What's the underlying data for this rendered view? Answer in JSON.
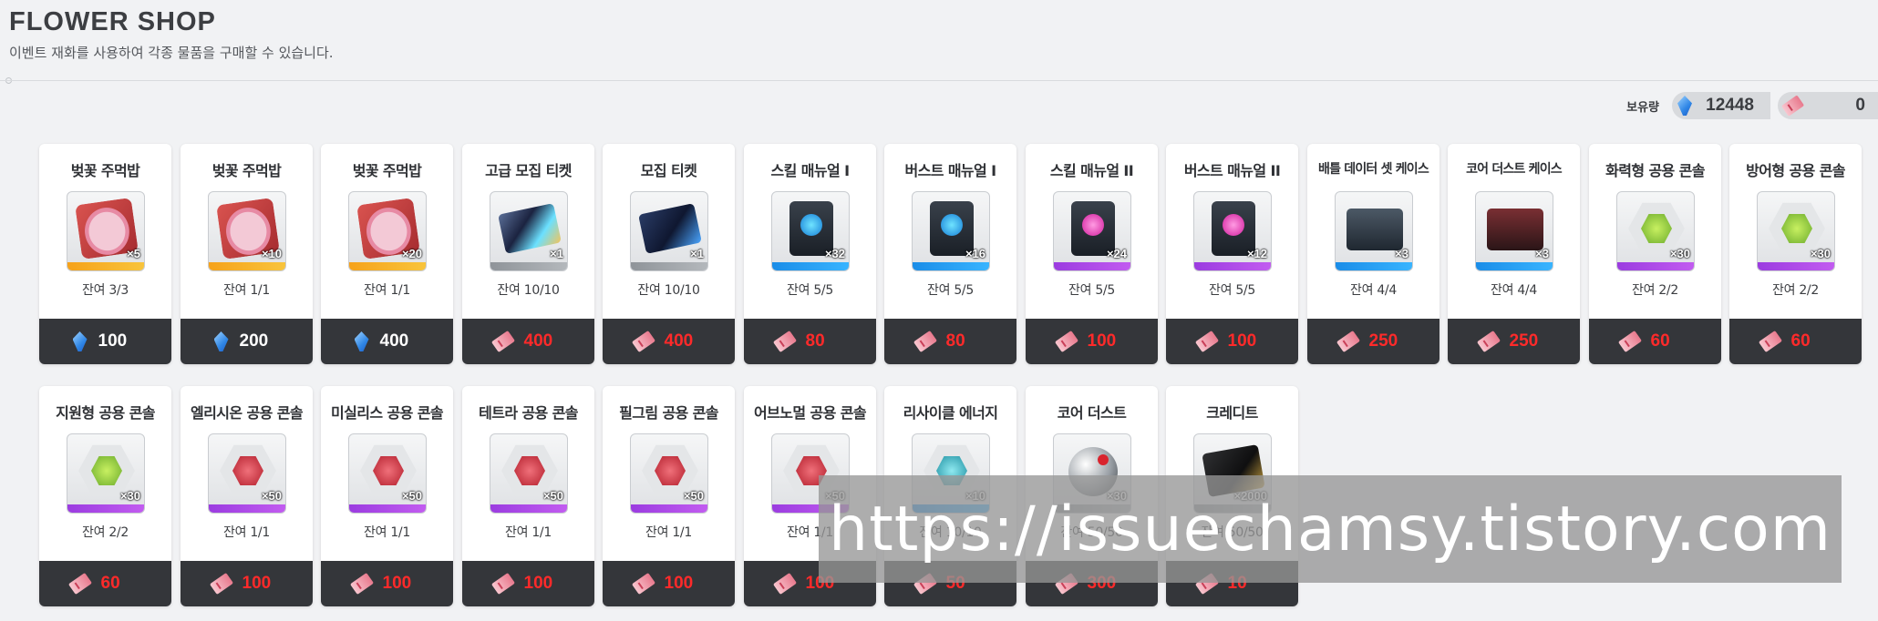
{
  "header": {
    "title": "FLOWER SHOP",
    "subtitle": "이벤트 재화를 사용하여 각종 물품을 구매할 수 있습니다."
  },
  "wallet": {
    "label": "보유량",
    "gem_amount": "12448",
    "ticket_amount": "0"
  },
  "items": [
    {
      "name": "벚꽃 주먹밥",
      "qty": "×5",
      "remain": "잔여 3/3",
      "currency": "gem",
      "price": "100",
      "rarity": "orange",
      "art": "rice"
    },
    {
      "name": "벚꽃 주먹밥",
      "qty": "×10",
      "remain": "잔여 1/1",
      "currency": "gem",
      "price": "200",
      "rarity": "orange",
      "art": "rice"
    },
    {
      "name": "벚꽃 주먹밥",
      "qty": "×20",
      "remain": "잔여 1/1",
      "currency": "gem",
      "price": "400",
      "rarity": "orange",
      "art": "rice"
    },
    {
      "name": "고급 모집 티켓",
      "qty": "×1",
      "remain": "잔여 10/10",
      "currency": "ticket",
      "price": "400",
      "rarity": "gray",
      "art": "ticket-gold"
    },
    {
      "name": "모집 티켓",
      "qty": "×1",
      "remain": "잔여 10/10",
      "currency": "ticket",
      "price": "400",
      "rarity": "gray",
      "art": "ticket"
    },
    {
      "name": "스킬 매뉴얼 I",
      "qty": "×32",
      "remain": "잔여 5/5",
      "currency": "ticket",
      "price": "80",
      "rarity": "blue",
      "art": "manual-blue"
    },
    {
      "name": "버스트 매뉴얼 I",
      "qty": "×16",
      "remain": "잔여 5/5",
      "currency": "ticket",
      "price": "80",
      "rarity": "blue",
      "art": "manual-blue"
    },
    {
      "name": "스킬 매뉴얼 II",
      "qty": "×24",
      "remain": "잔여 5/5",
      "currency": "ticket",
      "price": "100",
      "rarity": "purple",
      "art": "manual-pink"
    },
    {
      "name": "버스트 매뉴얼 II",
      "qty": "×12",
      "remain": "잔여 5/5",
      "currency": "ticket",
      "price": "100",
      "rarity": "purple",
      "art": "manual-pink"
    },
    {
      "name": "배틀 데이터 셋 케이스",
      "qty": "×3",
      "remain": "잔여 4/4",
      "currency": "ticket",
      "price": "250",
      "rarity": "blue",
      "art": "case",
      "small": true
    },
    {
      "name": "코어 더스트 케이스",
      "qty": "×3",
      "remain": "잔여 4/4",
      "currency": "ticket",
      "price": "250",
      "rarity": "blue",
      "art": "case-red",
      "small": true
    },
    {
      "name": "화력형 공용 콘솔",
      "qty": "×30",
      "remain": "잔여 2/2",
      "currency": "ticket",
      "price": "60",
      "rarity": "purple",
      "art": "hex-green"
    },
    {
      "name": "방어형 공용 콘솔",
      "qty": "×30",
      "remain": "잔여 2/2",
      "currency": "ticket",
      "price": "60",
      "rarity": "purple",
      "art": "hex-green"
    },
    {
      "name": "지원형 공용 콘솔",
      "qty": "×30",
      "remain": "잔여 2/2",
      "currency": "ticket",
      "price": "60",
      "rarity": "purple",
      "art": "hex-green"
    },
    {
      "name": "엘리시온 공용 콘솔",
      "qty": "×50",
      "remain": "잔여 1/1",
      "currency": "ticket",
      "price": "100",
      "rarity": "purple",
      "art": "hex-red"
    },
    {
      "name": "미실리스 공용 콘솔",
      "qty": "×50",
      "remain": "잔여 1/1",
      "currency": "ticket",
      "price": "100",
      "rarity": "purple",
      "art": "hex-red"
    },
    {
      "name": "테트라 공용 콘솔",
      "qty": "×50",
      "remain": "잔여 1/1",
      "currency": "ticket",
      "price": "100",
      "rarity": "purple",
      "art": "hex-red"
    },
    {
      "name": "필그림 공용 콘솔",
      "qty": "×50",
      "remain": "잔여 1/1",
      "currency": "ticket",
      "price": "100",
      "rarity": "purple",
      "art": "hex-red"
    },
    {
      "name": "어브노멀 공용 콘솔",
      "qty": "×50",
      "remain": "잔여 1/1",
      "currency": "ticket",
      "price": "100",
      "rarity": "purple",
      "art": "hex-red"
    },
    {
      "name": "리사이클 에너지",
      "qty": "×10",
      "remain": "잔여 10/10",
      "currency": "ticket",
      "price": "50",
      "rarity": "blue",
      "art": "hex-teal"
    },
    {
      "name": "코어 더스트",
      "qty": "×30",
      "remain": "잔여 50/50",
      "currency": "ticket",
      "price": "300",
      "rarity": "gray",
      "art": "core"
    },
    {
      "name": "크레디트",
      "qty": "×2000",
      "remain": "잔여 50/50",
      "currency": "ticket",
      "price": "10",
      "rarity": "gray",
      "art": "credit"
    }
  ],
  "watermark": "https://issuechamsy.tistory.com",
  "colors": {
    "price_ticket": "#ff2a2a",
    "price_bar": "#34363a",
    "background": "#f1f2f4"
  }
}
